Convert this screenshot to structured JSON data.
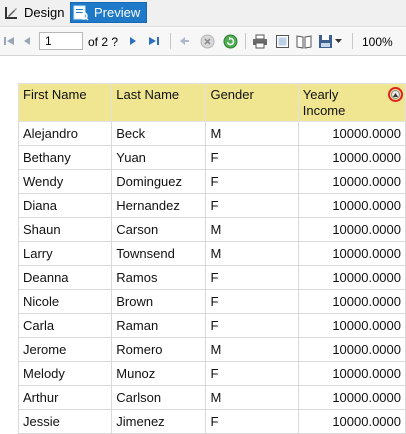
{
  "tabs": {
    "design": "Design",
    "preview": "Preview"
  },
  "toolbar": {
    "page_value": "1",
    "page_of": "of 2 ?",
    "zoom": "100%"
  },
  "table": {
    "headers": [
      "First Name",
      "Last Name",
      "Gender",
      "Yearly",
      "Income"
    ],
    "rows": [
      [
        "Alejandro",
        "Beck",
        "M",
        "10000.0000"
      ],
      [
        "Bethany",
        "Yuan",
        "F",
        "10000.0000"
      ],
      [
        "Wendy",
        "Dominguez",
        "F",
        "10000.0000"
      ],
      [
        "Diana",
        "Hernandez",
        "F",
        "10000.0000"
      ],
      [
        "Shaun",
        "Carson",
        "M",
        "10000.0000"
      ],
      [
        "Larry",
        "Townsend",
        "M",
        "10000.0000"
      ],
      [
        "Deanna",
        "Ramos",
        "F",
        "10000.0000"
      ],
      [
        "Nicole",
        "Brown",
        "F",
        "10000.0000"
      ],
      [
        "Carla",
        "Raman",
        "F",
        "10000.0000"
      ],
      [
        "Jerome",
        "Romero",
        "M",
        "10000.0000"
      ],
      [
        "Melody",
        "Munoz",
        "F",
        "10000.0000"
      ],
      [
        "Arthur",
        "Carlson",
        "M",
        "10000.0000"
      ],
      [
        "Jessie",
        "Jimenez",
        "F",
        "10000.0000"
      ]
    ]
  },
  "colors": {
    "header_bg": "#f0e591",
    "preview_tab": "#1e79c9",
    "sort_ring": "#e02020"
  }
}
